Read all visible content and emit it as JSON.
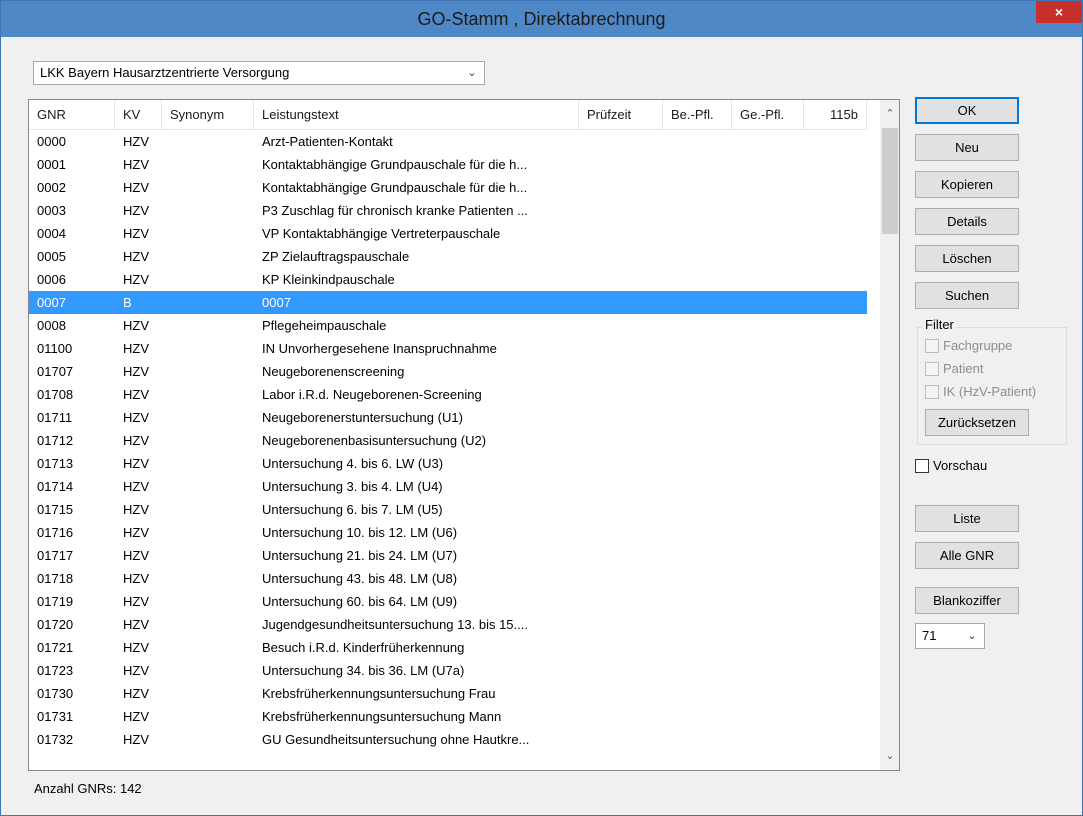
{
  "window": {
    "title": "GO-Stamm , Direktabrechnung",
    "close_glyph": "×"
  },
  "catalog_select": {
    "value": "LKK Bayern Hausarztzentrierte Versorgung",
    "arrow": "⌄"
  },
  "table": {
    "columns": [
      {
        "key": "gnr",
        "label": "GNR"
      },
      {
        "key": "kv",
        "label": "KV"
      },
      {
        "key": "synonym",
        "label": "Synonym"
      },
      {
        "key": "leistungstext",
        "label": "Leistungstext"
      },
      {
        "key": "pruefzeit",
        "label": "Prüfzeit"
      },
      {
        "key": "be_pfl",
        "label": "Be.-Pfl."
      },
      {
        "key": "ge_pfl",
        "label": "Ge.-Pfl."
      },
      {
        "key": "115b",
        "label": "115b"
      }
    ],
    "selected_index": 7,
    "rows": [
      {
        "gnr": "0000",
        "kv": "HZV",
        "synonym": "",
        "leistungstext": "Arzt-Patienten-Kontakt"
      },
      {
        "gnr": "0001",
        "kv": "HZV",
        "synonym": "",
        "leistungstext": "Kontaktabhängige Grundpauschale für die h..."
      },
      {
        "gnr": "0002",
        "kv": "HZV",
        "synonym": "",
        "leistungstext": "Kontaktabhängige Grundpauschale für die h..."
      },
      {
        "gnr": "0003",
        "kv": "HZV",
        "synonym": "",
        "leistungstext": "P3 Zuschlag für chronisch kranke Patienten ..."
      },
      {
        "gnr": "0004",
        "kv": "HZV",
        "synonym": "",
        "leistungstext": "VP Kontaktabhängige Vertreterpauschale"
      },
      {
        "gnr": "0005",
        "kv": "HZV",
        "synonym": "",
        "leistungstext": "ZP Zielauftragspauschale"
      },
      {
        "gnr": "0006",
        "kv": "HZV",
        "synonym": "",
        "leistungstext": "KP Kleinkindpauschale"
      },
      {
        "gnr": "0007",
        "kv": "B",
        "synonym": "",
        "leistungstext": "0007"
      },
      {
        "gnr": "0008",
        "kv": "HZV",
        "synonym": "",
        "leistungstext": "Pflegeheimpauschale"
      },
      {
        "gnr": "01100",
        "kv": "HZV",
        "synonym": "",
        "leistungstext": "IN Unvorhergesehene Inanspruchnahme"
      },
      {
        "gnr": "01707",
        "kv": "HZV",
        "synonym": "",
        "leistungstext": "Neugeborenenscreening"
      },
      {
        "gnr": "01708",
        "kv": "HZV",
        "synonym": "",
        "leistungstext": "Labor i.R.d. Neugeborenen-Screening"
      },
      {
        "gnr": "01711",
        "kv": "HZV",
        "synonym": "",
        "leistungstext": "Neugeborenerstuntersuchung (U1)"
      },
      {
        "gnr": "01712",
        "kv": "HZV",
        "synonym": "",
        "leistungstext": "Neugeborenenbasisuntersuchung (U2)"
      },
      {
        "gnr": "01713",
        "kv": "HZV",
        "synonym": "",
        "leistungstext": "Untersuchung 4. bis 6. LW (U3)"
      },
      {
        "gnr": "01714",
        "kv": "HZV",
        "synonym": "",
        "leistungstext": "Untersuchung 3. bis 4. LM (U4)"
      },
      {
        "gnr": "01715",
        "kv": "HZV",
        "synonym": "",
        "leistungstext": "Untersuchung 6. bis 7. LM (U5)"
      },
      {
        "gnr": "01716",
        "kv": "HZV",
        "synonym": "",
        "leistungstext": "Untersuchung 10. bis 12. LM (U6)"
      },
      {
        "gnr": "01717",
        "kv": "HZV",
        "synonym": "",
        "leistungstext": "Untersuchung 21. bis 24. LM (U7)"
      },
      {
        "gnr": "01718",
        "kv": "HZV",
        "synonym": "",
        "leistungstext": "Untersuchung 43. bis 48. LM (U8)"
      },
      {
        "gnr": "01719",
        "kv": "HZV",
        "synonym": "",
        "leistungstext": "Untersuchung 60. bis 64. LM (U9)"
      },
      {
        "gnr": "01720",
        "kv": "HZV",
        "synonym": "",
        "leistungstext": "Jugendgesundheitsuntersuchung 13. bis 15...."
      },
      {
        "gnr": "01721",
        "kv": "HZV",
        "synonym": "",
        "leistungstext": "Besuch i.R.d. Kinderfrüherkennung"
      },
      {
        "gnr": "01723",
        "kv": "HZV",
        "synonym": "",
        "leistungstext": "Untersuchung 34. bis 36. LM (U7a)"
      },
      {
        "gnr": "01730",
        "kv": "HZV",
        "synonym": "",
        "leistungstext": "Krebsfrüherkennungsuntersuchung Frau"
      },
      {
        "gnr": "01731",
        "kv": "HZV",
        "synonym": "",
        "leistungstext": "Krebsfrüherkennungsuntersuchung Mann"
      },
      {
        "gnr": "01732",
        "kv": "HZV",
        "synonym": "",
        "leistungstext": "GU Gesundheitsuntersuchung ohne Hautkre..."
      }
    ]
  },
  "scrollbar": {
    "up": "⌃",
    "down": "⌄"
  },
  "status": {
    "count_text": "Anzahl GNRs: 142"
  },
  "buttons": {
    "ok": "OK",
    "neu": "Neu",
    "kopieren": "Kopieren",
    "details": "Details",
    "loeschen": "Löschen",
    "suchen": "Suchen",
    "zuruecksetzen": "Zurücksetzen",
    "liste": "Liste",
    "alle_gnr": "Alle GNR",
    "blankoziffer": "Blankoziffer"
  },
  "filter": {
    "label": "Filter",
    "fachgruppe": "Fachgruppe",
    "patient": "Patient",
    "ik": "IK (HzV-Patient)"
  },
  "vorschau": {
    "label": "Vorschau"
  },
  "number_select": {
    "value": "71",
    "arrow": "⌄"
  },
  "colors": {
    "title_bar": "#4f88c6",
    "close_button": "#c7302b",
    "selection": "#3399ff",
    "default_button_border": "#0078d7"
  }
}
